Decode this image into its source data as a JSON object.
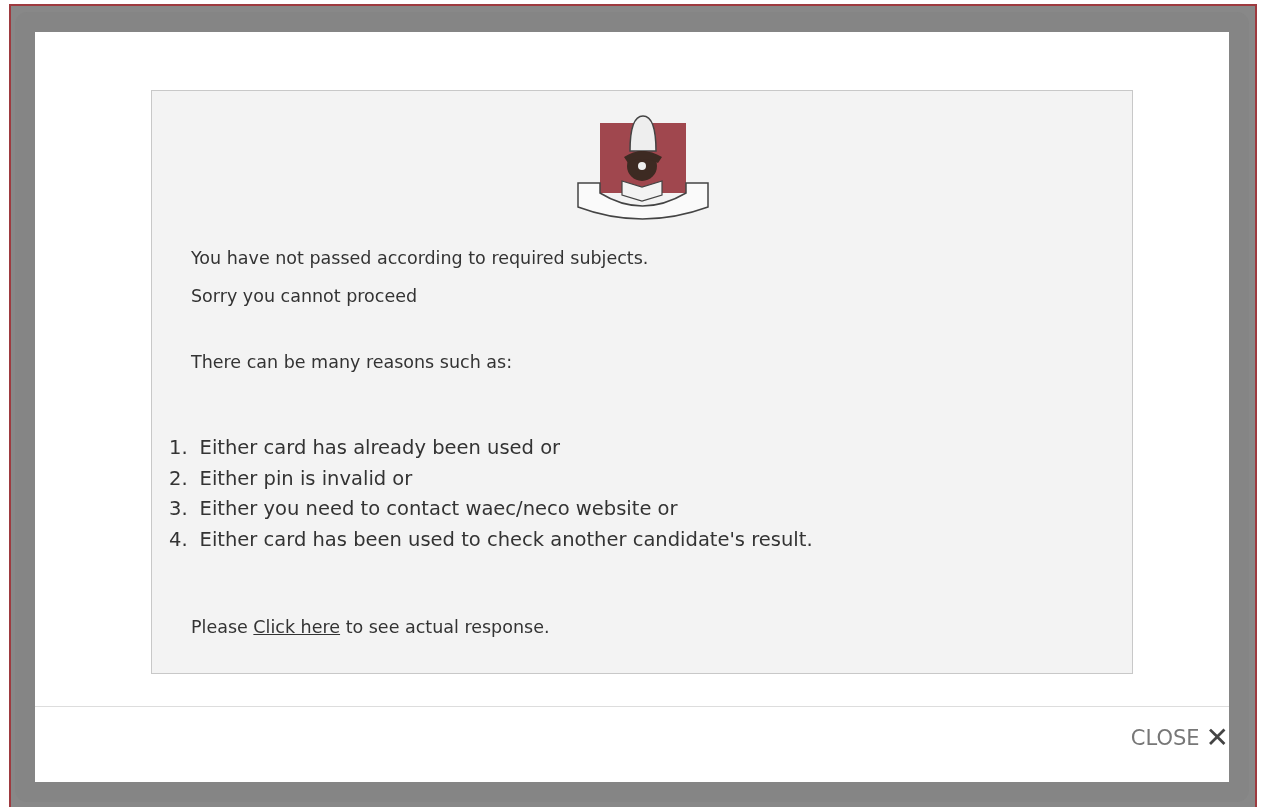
{
  "message": {
    "lines": [
      "You have not passed according to required subjects.",
      "Sorry you cannot proceed"
    ],
    "reasons_intro": "There can be many reasons such as:",
    "reasons": [
      {
        "number": "1.",
        "text": "Either card has already been used or"
      },
      {
        "number": "2.",
        "text": "Either pin is invalid or"
      },
      {
        "number": "3.",
        "text": "Either you need to contact waec/neco website or"
      },
      {
        "number": "4.",
        "text": "Either card has been used to check another candidate's result."
      }
    ],
    "footer": {
      "before": "Please",
      "link": "Click here",
      "after": "to see actual response."
    }
  },
  "close_button": {
    "label": "CLOSE",
    "icon": "✕"
  }
}
